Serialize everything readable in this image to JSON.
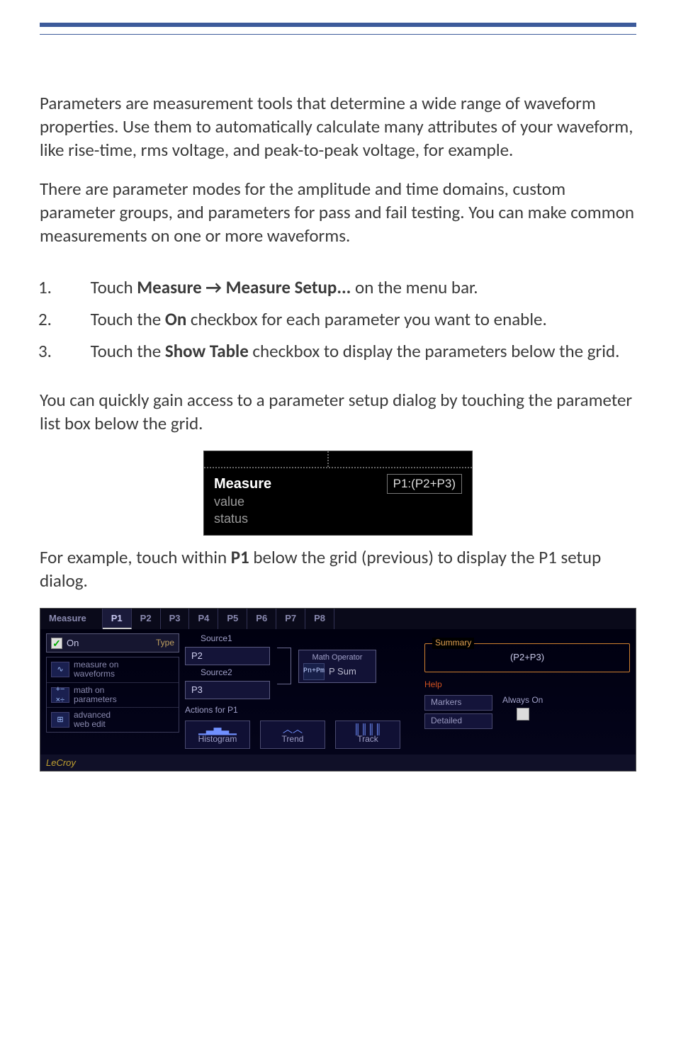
{
  "top": {
    "para1": "Parameters are measurement tools that determine a wide range of waveform properties. Use them to automatically calculate many attributes of your waveform, like rise-time, rms voltage, and peak-to-peak voltage, for example.",
    "para2": "There are parameter modes for the amplitude and time domains, custom parameter groups, and parameters for pass and fail testing. You can make common measurements on one or more waveforms."
  },
  "steps": {
    "s1a": "Touch ",
    "s1b": "Measure → Measure Setup...",
    "s1c": " on the menu bar.",
    "s2a": "Touch the ",
    "s2b": "On",
    "s2c": " checkbox for each parameter you want to enable.",
    "s3a": "Touch the ",
    "s3b": "Show Table",
    "s3c": " checkbox to display the parameters below the grid."
  },
  "mid": {
    "para": "You can quickly gain access to a parameter setup dialog by touching the parameter list box below the grid."
  },
  "shot1": {
    "measure": "Measure",
    "value": "value",
    "status": "status",
    "pbox": "P1:(P2+P3)"
  },
  "after": {
    "para_a": "For example, touch within ",
    "para_b": "P1",
    "para_c": " below the grid (previous) to display the P1 setup dialog."
  },
  "shot2": {
    "tabs": [
      "Measure",
      "P1",
      "P2",
      "P3",
      "P4",
      "P5",
      "P6",
      "P7",
      "P8"
    ],
    "on": "On",
    "type": "Type",
    "menu": {
      "m1": "measure on\nwaveforms",
      "m2": "math on\nparameters",
      "m3": "advanced\nweb edit"
    },
    "source1": "Source1",
    "source2": "Source2",
    "p2": "P2",
    "p3": "P3",
    "mathop": "Math Operator",
    "psum": "P Sum",
    "psumicon": "Pn+Pm",
    "actions": "Actions for P1",
    "histogram": "Histogram",
    "trend": "Trend",
    "track": "Track",
    "summary": "Summary",
    "sumval": "(P2+P3)",
    "help": "Help",
    "markers": "Markers",
    "detailed": "Detailed",
    "always": "Always On",
    "brand": "LeCroy"
  }
}
